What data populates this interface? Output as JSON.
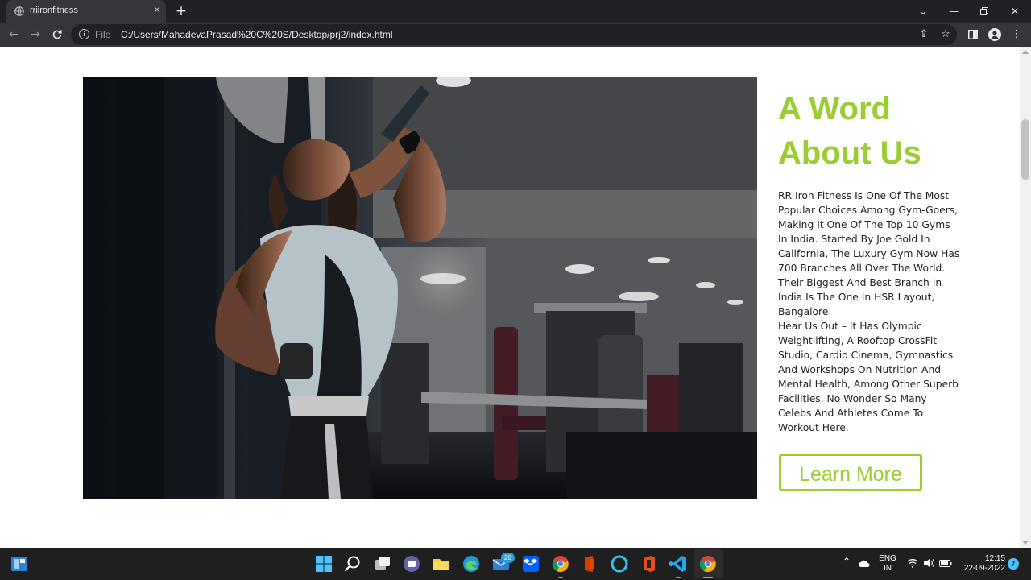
{
  "browser": {
    "tab_title": "rriironfitness",
    "file_label": "File",
    "url": "C:/Users/MahadevaPrasad%20C%20S/Desktop/prj2/index.html"
  },
  "page": {
    "about_title": "A Word About Us",
    "about_paragraph_1": "RR Iron Fitness Is One Of The Most Popular Choices Among Gym-Goers, Making It One Of The Top 10 Gyms In India. Started By Joe Gold In California, The Luxury Gym Now Has 700 Branches All Over The World. Their Biggest And Best Branch In India Is The One In HSR Layout, Bangalore.",
    "about_paragraph_2": "Hear Us Out – It Has Olympic Weightlifting, A Rooftop CrossFit Studio, Cardio Cinema, Gymnastics And Workshops On Nutrition And Mental Health, Among Other Superb Facilities. No Wonder So Many Celebs And Athletes Come To Workout Here.",
    "learn_more_label": "Learn More",
    "accent_color": "#9acd32"
  },
  "taskbar": {
    "mail_badge": "28",
    "language": "ENG",
    "region": "IN",
    "time": "12:15",
    "date": "22-09-2022",
    "notification_count": "7"
  }
}
